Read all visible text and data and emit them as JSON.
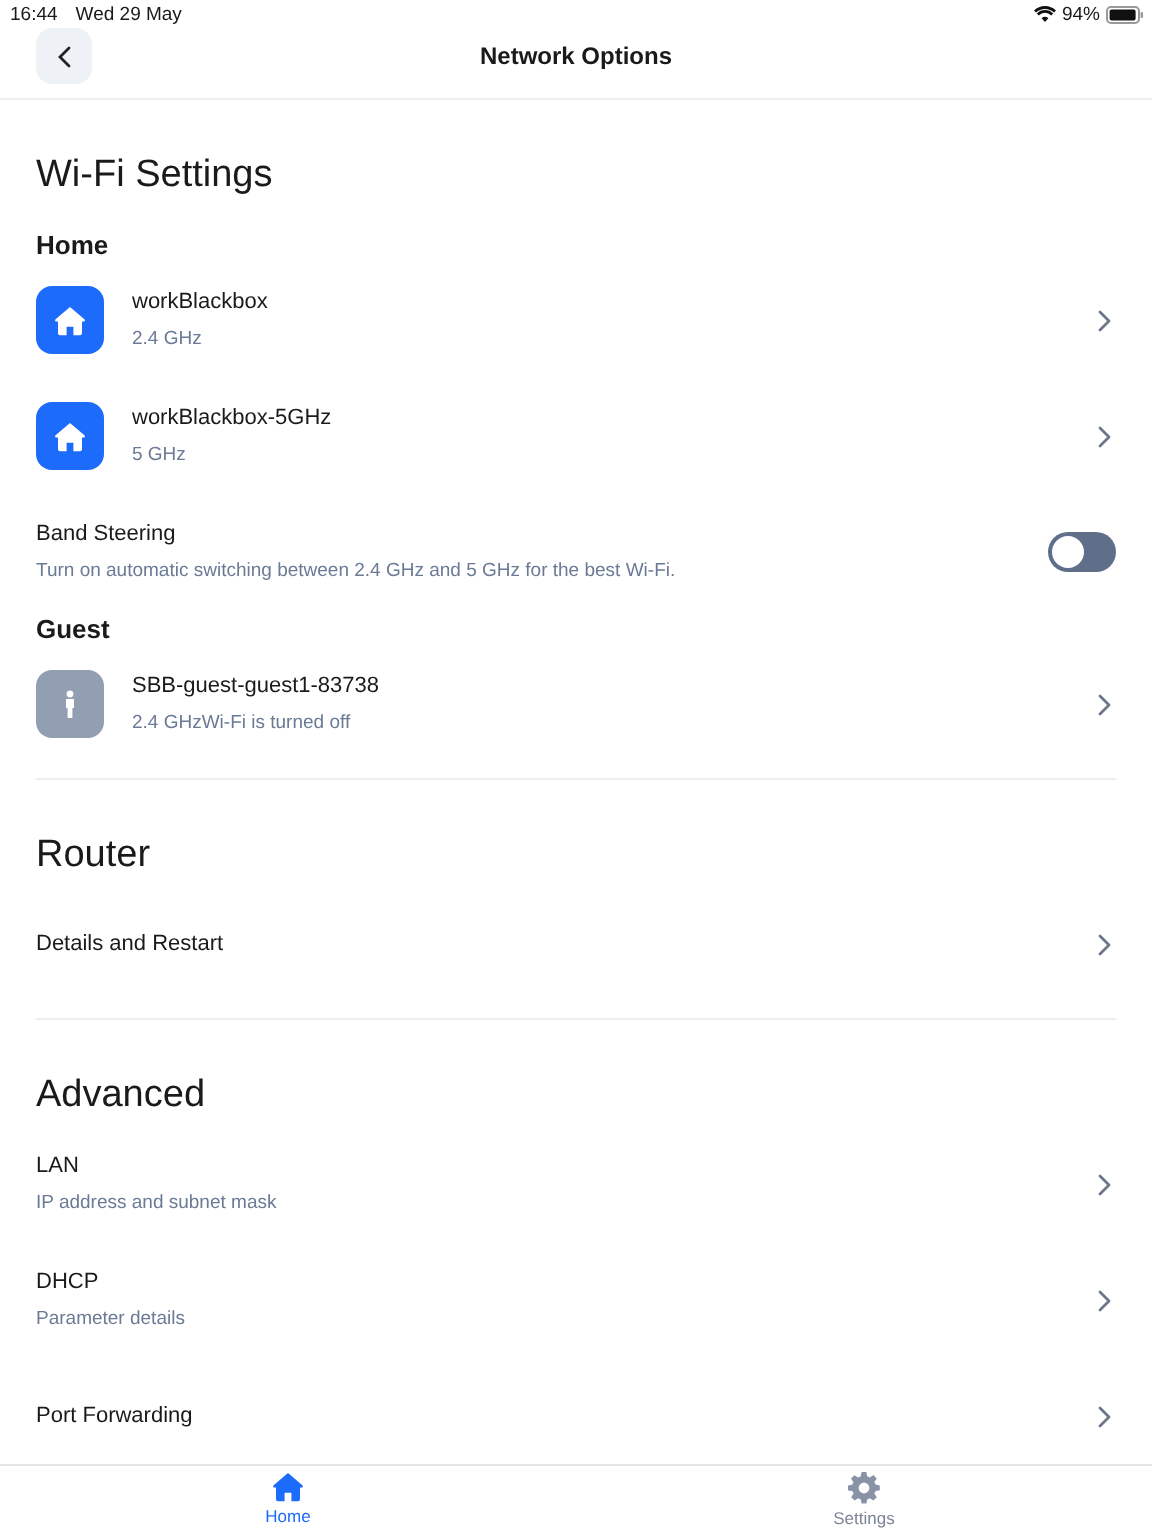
{
  "status_bar": {
    "time": "16:44",
    "date": "Wed 29 May",
    "battery": "94%"
  },
  "header": {
    "title": "Network Options"
  },
  "sections": [
    {
      "title": "Wi-Fi Settings",
      "items": [
        {
          "kind": "label",
          "text": "Home"
        },
        {
          "kind": "home_network",
          "name": "workBlackbox",
          "detail": "2.4 GHz"
        },
        {
          "kind": "home_network",
          "name": "workBlackbox-5GHz",
          "detail": "5 GHz"
        },
        {
          "kind": "toggle",
          "name": "Band Steering",
          "detail": "Turn on automatic switching between 2.4 GHz and 5 GHz for the best Wi-Fi.",
          "on": false
        },
        {
          "kind": "label",
          "text": "Guest"
        },
        {
          "kind": "guest_network",
          "name": "SBB-guest-guest1-83738",
          "detail": "2.4 GHzWi-Fi is turned off"
        }
      ]
    },
    {
      "title": "Router",
      "items": [
        {
          "kind": "link",
          "name": "Details and Restart"
        }
      ]
    },
    {
      "title": "Advanced",
      "items": [
        {
          "kind": "link",
          "name": "LAN",
          "detail": "IP address and subnet mask"
        },
        {
          "kind": "link",
          "name": "DHCP",
          "detail": "Parameter details"
        },
        {
          "kind": "link",
          "name": "Port Forwarding"
        }
      ]
    }
  ],
  "tab_bar": [
    {
      "label": "Home",
      "selected": true
    },
    {
      "label": "Settings",
      "selected": false
    }
  ]
}
